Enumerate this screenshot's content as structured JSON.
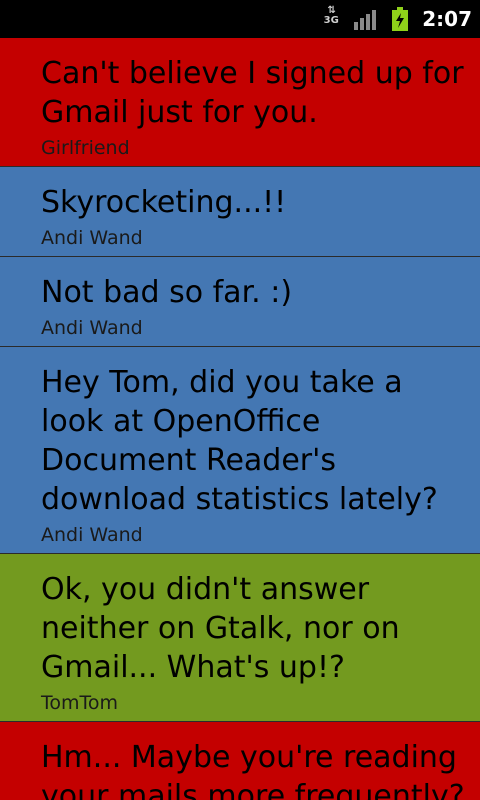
{
  "status_bar": {
    "network_label": "3G",
    "time": "2:07",
    "signal_icon": "signal-strength-icon",
    "battery_icon": "battery-charging-icon",
    "battery_color": "#8fd11a"
  },
  "colors": {
    "red": "#c40000",
    "blue": "#4477b3",
    "green": "#739a1f"
  },
  "messages": [
    {
      "text": "Can't believe I signed up for Gmail just for you.",
      "author": "Girlfriend",
      "color": "red"
    },
    {
      "text": "Skyrocketing...!!",
      "author": "Andi Wand",
      "color": "blue"
    },
    {
      "text": "Not bad so far. :)",
      "author": "Andi Wand",
      "color": "blue"
    },
    {
      "text": "Hey Tom, did you take a look at OpenOffice Document Reader's download statistics lately?",
      "author": "Andi Wand",
      "color": "blue"
    },
    {
      "text": "Ok, you didn't answer neither on Gtalk, nor on Gmail... What's up!?",
      "author": "TomTom",
      "color": "green"
    },
    {
      "text": "Hm... Maybe you're reading your mails more frequently?",
      "author": "",
      "color": "red"
    }
  ]
}
